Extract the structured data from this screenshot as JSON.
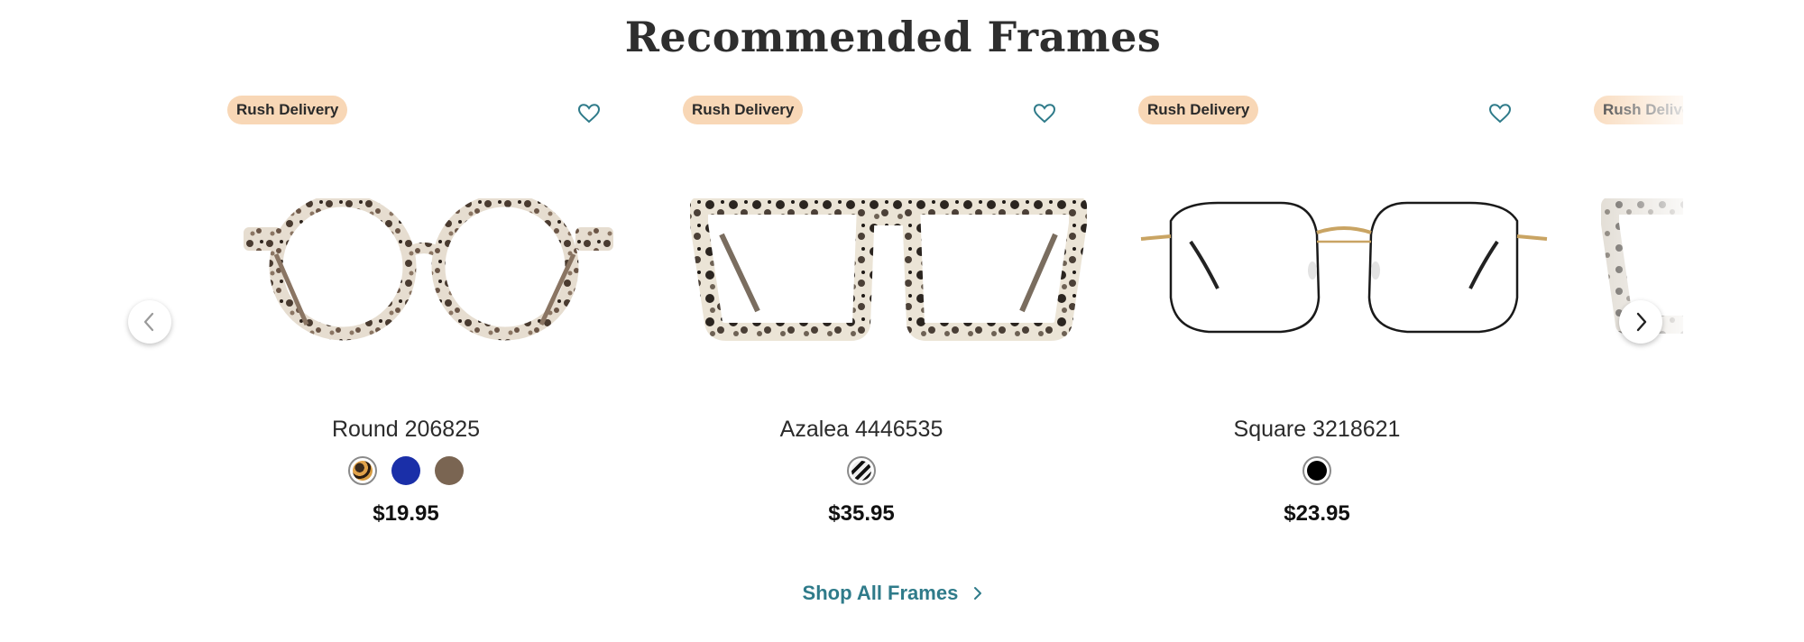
{
  "section": {
    "title": "Recommended Frames",
    "shop_all_label": "Shop All Frames",
    "accent_color": "#2f7b8a",
    "badge_color": "#f8d7b6"
  },
  "products": [
    {
      "badge": "Rush Delivery",
      "name": "Round 206825",
      "price": "$19.95",
      "frame_style": "round-tortoise",
      "swatches": [
        {
          "color": "tortoise",
          "selected": true
        },
        {
          "color": "#1a2fa8",
          "selected": false
        },
        {
          "color": "#7a6552",
          "selected": false
        }
      ]
    },
    {
      "badge": "Rush Delivery",
      "name": "Azalea 4446535",
      "price": "$35.95",
      "frame_style": "square-tortoise",
      "swatches": [
        {
          "color": "black-white-stripe",
          "selected": true
        }
      ]
    },
    {
      "badge": "Rush Delivery",
      "name": "Square 3218621",
      "price": "$23.95",
      "frame_style": "thin-metal-octagon",
      "swatches": [
        {
          "color": "#000000",
          "selected": true
        }
      ]
    },
    {
      "badge": "Rush Delivery",
      "name": "",
      "price": "",
      "frame_style": "square-tortoise-partial",
      "swatches": []
    }
  ],
  "icons": {
    "wishlist": "heart-outline-icon",
    "prev": "chevron-left-icon",
    "next": "chevron-right-icon",
    "shop_all": "chevron-right-icon"
  }
}
